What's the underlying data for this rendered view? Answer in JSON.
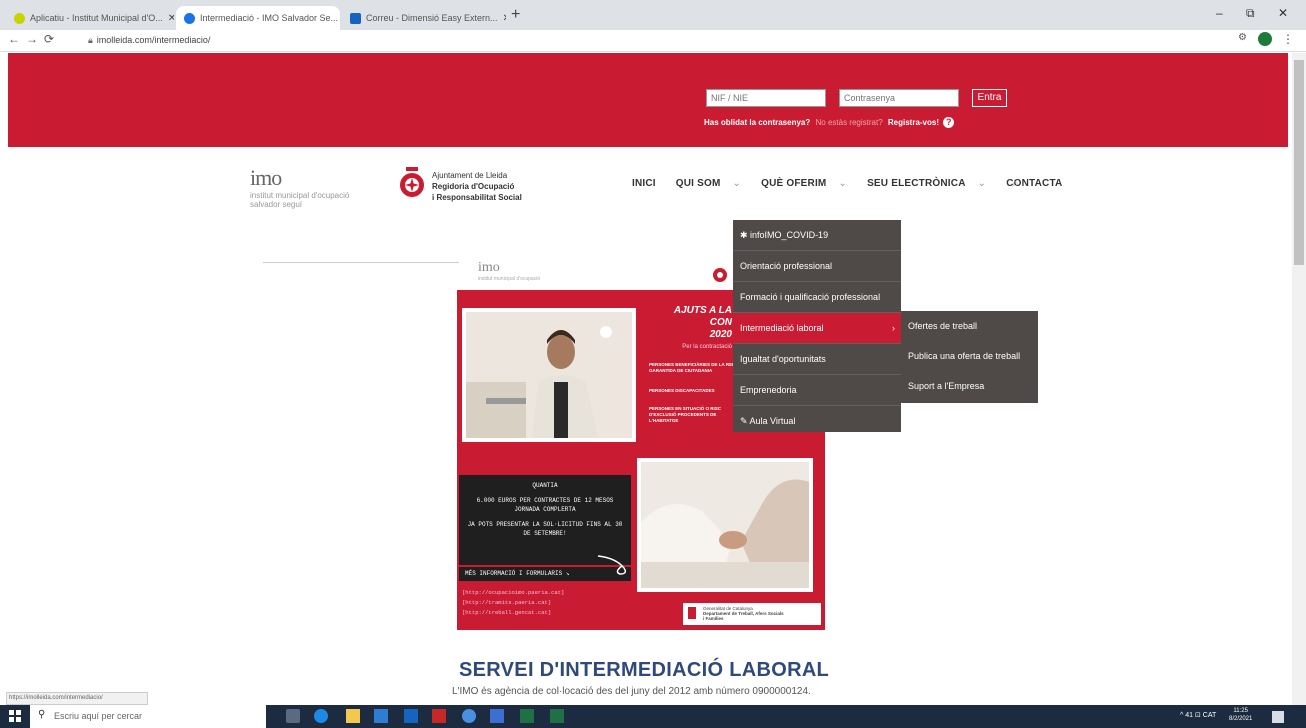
{
  "browser": {
    "tabs": [
      {
        "title": "Aplicatiu - Institut Municipal d'O...",
        "color": "#c8d400"
      },
      {
        "title": "Intermediació - IMO Salvador Se...",
        "color": "#1a73e8"
      },
      {
        "title": "Correu - Dimensió Easy Extern...",
        "color": "#1565c0"
      }
    ],
    "url": "imolleida.com/intermediacio/"
  },
  "login": {
    "nif_placeholder": "NIF / NIE",
    "password_placeholder": "Contrasenya",
    "submit_label": "Entra",
    "forgot_label": "Has oblidat la contrasenya?",
    "not_registered_label": "No estàs registrat?",
    "register_label": "Registra-vos!",
    "help_icon": "?"
  },
  "branding": {
    "logo_text": "imo",
    "logo_sub1": "institut municipal d'ocupació",
    "logo_sub2": "salvador seguí",
    "ajuntament_line1": "Ajuntament de Lleida",
    "ajuntament_line2": "Regidoria d'Ocupació",
    "ajuntament_line3": "i Responsabilitat Social"
  },
  "nav": {
    "items": [
      "INICI",
      "QUI SOM",
      "QUÈ OFERIM",
      "SEU ELECTRÒNICA",
      "CONTACTA"
    ],
    "dropdown_arrow": "⌄"
  },
  "menu": {
    "items": [
      "infoIMO_COVID-19",
      "Orientació professional",
      "Formació i qualificació professional",
      "Intermediació laboral",
      "Igualtat d'oportunitats",
      "Emprenedoria",
      "Aula Virtual"
    ],
    "active_arrow": "›"
  },
  "submenu": {
    "items": [
      "Ofertes de treball",
      "Publica una oferta de treball",
      "Suport a l'Empresa"
    ]
  },
  "poster": {
    "title_line1": "AJUTS A LA CON",
    "title_line2": "2020",
    "subtitle": "Per la contractació",
    "bullets": [
      "PERSONES BENEFICIÀRIES DE LA RENDA",
      "GARANTIDA DE CIUTADANIA",
      "PERSONES DISCAPACITADES",
      "PERSONES EN SITUACIÓ O RISC",
      "D'EXCLUSIÓ PROCEDENTS DE",
      "L'HABITATGE"
    ],
    "quantia_title": "QUANTIA",
    "quantia_text": "6.000 EUROS PER CONTRACTES DE 12 MESOS JORNADA COMPLERTA",
    "deadline_text": "JA POTS PRESENTAR LA SOL·LICITUD FINS AL 30 DE SETEMBRE!",
    "more_info": "MÉS INFORMACIÓ I FORMULARIS ↘",
    "links": [
      "[http://ocupacioimo.paeria.cat]",
      "[http://tramits.paeria.cat]",
      "[http://treball.gencat.cat]"
    ],
    "seal_line1": "Generalitat de Catalunya",
    "seal_line2": "Departament de Treball, Afers Socials",
    "seal_line3": "i Famílies",
    "logo_text": "imo"
  },
  "page": {
    "heading": "SERVEI D'INTERMEDIACIÓ LABORAL",
    "intro": "L'IMO és agència de col·locació des del juny del 2012 amb número 0900000124."
  },
  "status": {
    "url": "https://imolleida.com/intermediacio/"
  },
  "taskbar": {
    "search_placeholder": "Escriu aquí per cercar",
    "time": "11:25",
    "date": "8/2/2021",
    "tray": "^ 41 ⊡ CAT"
  }
}
